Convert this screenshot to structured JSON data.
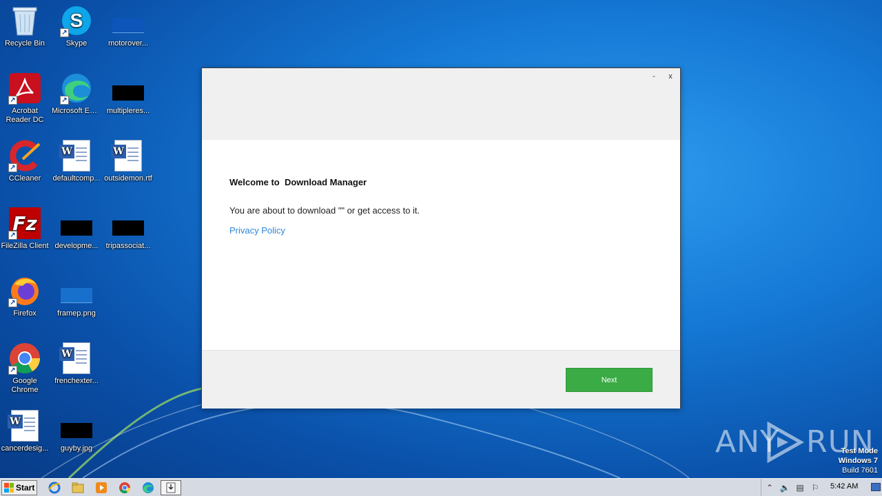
{
  "desktop": {
    "icons": [
      {
        "label": "Recycle Bin"
      },
      {
        "label": "Skype"
      },
      {
        "label": "motorover..."
      },
      {
        "label": "Acrobat Reader DC"
      },
      {
        "label": "Microsoft Edge"
      },
      {
        "label": "multipleres..."
      },
      {
        "label": "CCleaner"
      },
      {
        "label": "defaultcomp..."
      },
      {
        "label": "outsidemon.rtf"
      },
      {
        "label": "FileZilla Client"
      },
      {
        "label": "developme..."
      },
      {
        "label": "tripassociat..."
      },
      {
        "label": "Firefox"
      },
      {
        "label": "framep.png"
      },
      {
        "label": "Google Chrome"
      },
      {
        "label": "frenchexter..."
      },
      {
        "label": "cancerdesig..."
      },
      {
        "label": "guyby.jpg"
      }
    ]
  },
  "dialog": {
    "minimize_label": "-",
    "close_label": "x",
    "title": "Welcome to  Download Manager",
    "text": "You are about to download \"\" or get access to it.",
    "privacy_link": "Privacy Policy",
    "next_label": "Next",
    "accent_color": "#3bab45",
    "link_color": "#2f86d8"
  },
  "watermark": {
    "any": "ANY",
    "run": "RUN"
  },
  "windows_info": {
    "line1": "Test Mode",
    "line2": "Windows 7",
    "line3": "Build 7601"
  },
  "taskbar": {
    "start_label": "Start",
    "pinned": [
      {
        "icon": "internet-explorer-icon"
      },
      {
        "icon": "file-explorer-icon"
      },
      {
        "icon": "media-player-icon"
      },
      {
        "icon": "chrome-icon"
      },
      {
        "icon": "edge-icon"
      },
      {
        "icon": "download-manager-icon"
      }
    ],
    "clock": "5:42 AM"
  }
}
